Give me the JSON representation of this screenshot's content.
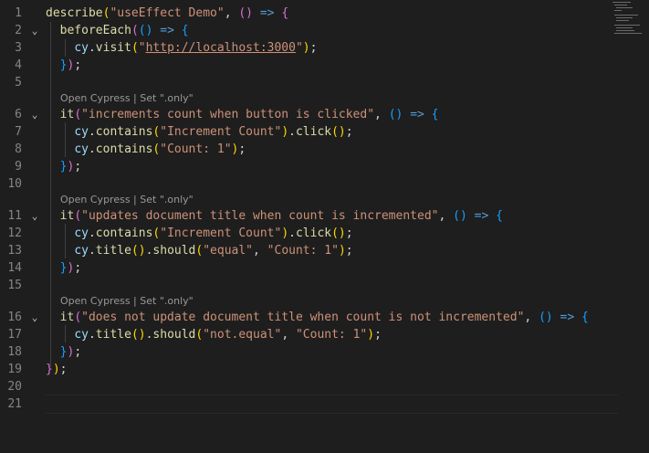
{
  "editor": {
    "line_numbers": [
      "1",
      "2",
      "3",
      "4",
      "5",
      "6",
      "7",
      "8",
      "9",
      "10",
      "11",
      "12",
      "13",
      "14",
      "15",
      "16",
      "17",
      "18",
      "19",
      "20",
      "21"
    ],
    "codelens": {
      "open": "Open Cypress",
      "sep": " | ",
      "only": "Set \".only\""
    },
    "tokens": {
      "describe": "describe",
      "describe_title": "\"useEffect Demo\"",
      "beforeEach": "beforeEach",
      "cy": "cy",
      "visit": "visit",
      "url_quote_open": "\"",
      "url": "http://localhost:3000",
      "url_quote_close": "\"",
      "it": "it",
      "test1_title": "\"increments count when button is clicked\"",
      "contains": "contains",
      "click": "click",
      "str_increment": "\"Increment Count\"",
      "str_count1": "\"Count: 1\"",
      "test2_title": "\"updates document title when count is incremented\"",
      "title": "title",
      "should": "should",
      "str_equal": "\"equal\"",
      "test3_title": "\"does not update document title when count is not incremented\"",
      "str_not_equal": "\"not.equal\""
    }
  }
}
